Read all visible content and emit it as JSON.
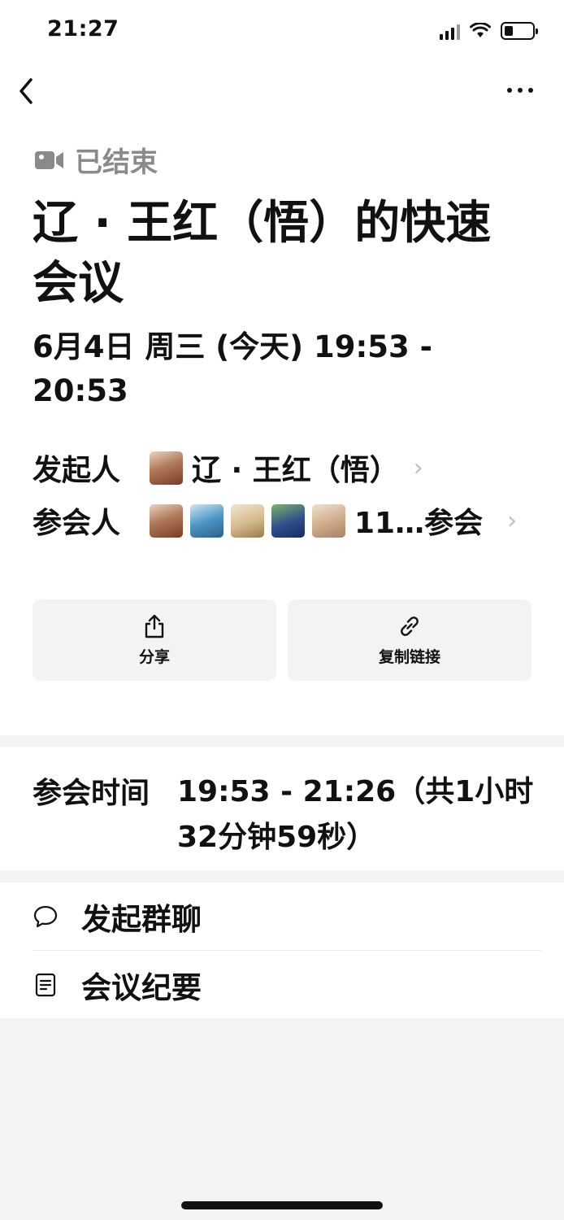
{
  "status_bar": {
    "time": "21:27"
  },
  "meeting": {
    "status_label": "已结束",
    "title": "辽 · 王红（悟）的快速会议",
    "time_range": "6月4日 周三 (今天) 19:53 - 20:53",
    "organizer": {
      "label": "发起人",
      "name": "辽 · 王红（悟）"
    },
    "attendees": {
      "label": "参会人",
      "summary": "11…参会"
    }
  },
  "actions": {
    "share_label": "分享",
    "copy_link_label": "复制链接"
  },
  "duration": {
    "label": "参会时间",
    "value": "19:53 - 21:26（共1小时32分钟59秒）"
  },
  "menu": {
    "group_chat_label": "发起群聊",
    "minutes_label": "会议纪要"
  }
}
